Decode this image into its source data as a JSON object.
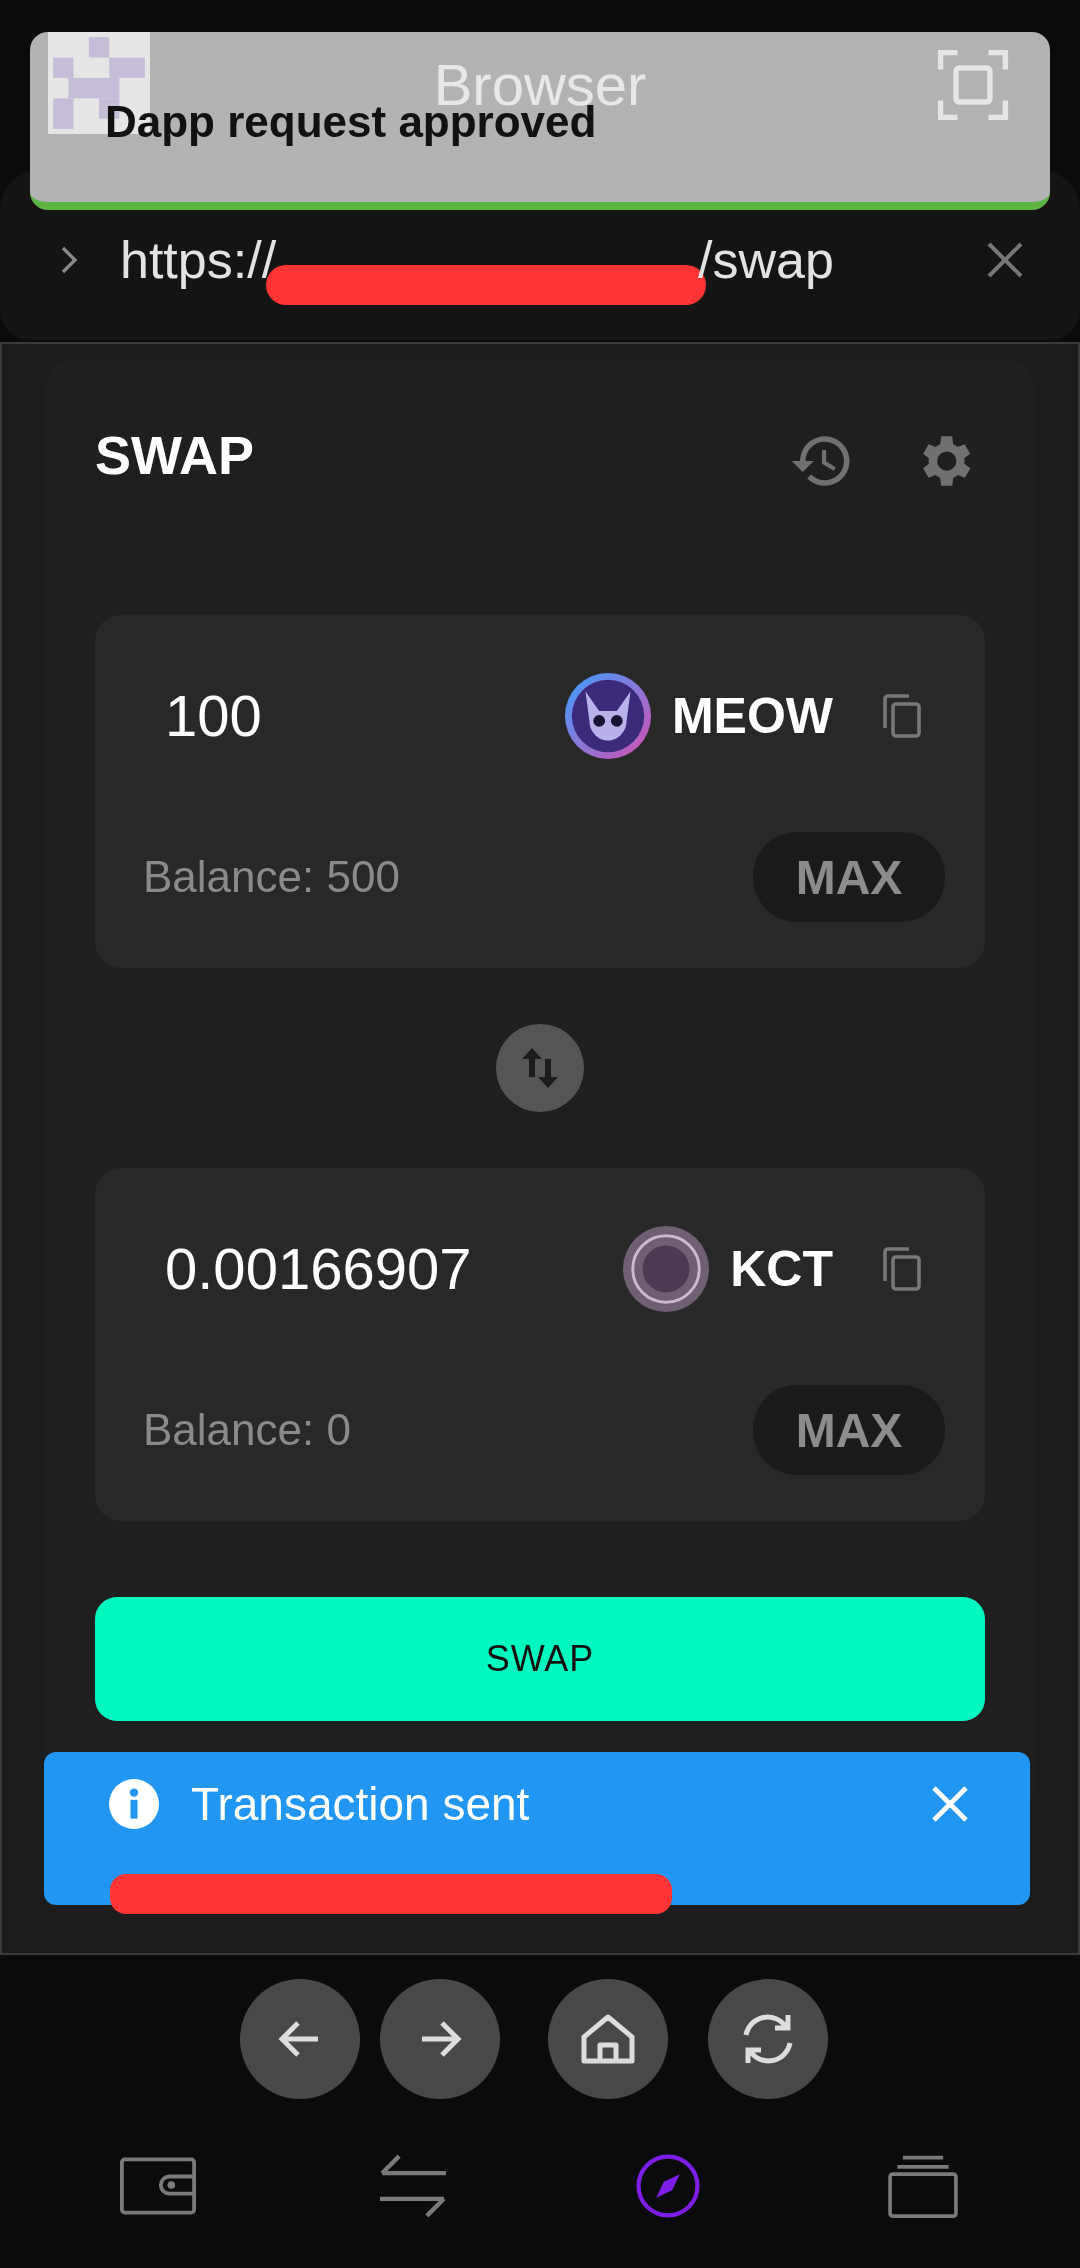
{
  "notification": {
    "app_title": "Browser",
    "message": "Dapp request approved"
  },
  "address_bar": {
    "url_start": "https://",
    "url_end": "/swap"
  },
  "swap_card": {
    "title": "SWAP",
    "tokens": [
      {
        "amount": "100",
        "symbol": "MEOW",
        "balance": "Balance: 500",
        "max_label": "MAX",
        "kind": "cat"
      },
      {
        "amount": "0.00166907",
        "symbol": "KCT",
        "balance": "Balance: 0",
        "max_label": "MAX",
        "kind": "coin"
      }
    ],
    "swap_button": "SWAP"
  },
  "toast": {
    "message": "Transaction sent"
  },
  "nav_buttons": [
    {
      "kind": "back"
    },
    {
      "kind": "forward"
    },
    {
      "kind": "home"
    },
    {
      "kind": "refresh"
    }
  ],
  "tabs": [
    {
      "kind": "wallet",
      "selected": false
    },
    {
      "kind": "swap",
      "selected": false
    },
    {
      "kind": "browser",
      "selected": true
    },
    {
      "kind": "tabs",
      "selected": false
    }
  ]
}
